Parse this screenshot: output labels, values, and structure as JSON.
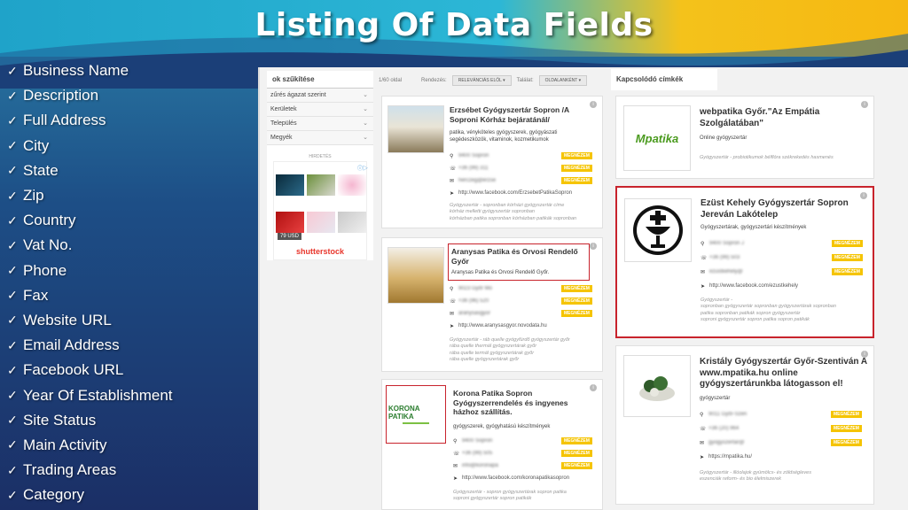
{
  "slide": {
    "title": "Listing Of Data Fields",
    "fields": [
      "Business Name",
      "Description",
      "Full Address",
      "City",
      "State",
      "Zip",
      "Country",
      "Vat No.",
      "Phone",
      "Fax",
      "Website URL",
      "Email Address",
      "Facebook URL",
      "Year Of Establishment",
      "Site Status",
      "Main Activity",
      "Trading Areas",
      "Category"
    ]
  },
  "colors": {
    "accent_red": "#c8232c",
    "badge_yellow": "#f5c400",
    "title_white": "#ffffff"
  },
  "screenshot": {
    "sidebar": {
      "header": "ok szűkítése",
      "items": [
        "zűrés ágazat szerint",
        "Kerületek",
        "Település",
        "Megyék"
      ],
      "ad_label": "HIRDETÉS",
      "ad_price": "79 USD",
      "ad_logo": "shutterstock"
    },
    "toolbar": {
      "pages": "1/60 oldal",
      "sort_label": "Rendezés:",
      "sort_value": "RELEVÁNCIÁS ELŐL",
      "hits_label": "Találat:",
      "hits_value": "OLDALANKÉNT"
    },
    "related_header": "Kapcsolódó címkék",
    "badge_label": "MEGNÉZEM",
    "cards": [
      {
        "title": "Erzsébet Gyógyszertár Sopron /A Soproni Kórház bejáratánál/",
        "subtitle": "patika, vényköteles gyógyszerek, gyógyászati segédeszközök, vitaminok, kozmetikumok",
        "address": "9400 Sopron",
        "phone": "+36 (99) 311",
        "email": "herczeg@erzse",
        "url": "http://www.facebook.com/ErzsebetPatikaSopron",
        "tags": [
          "Gyógyszertár - sopronban kórházi gyógyszertár címe",
          "kórház melletti gyógyszertár sopronban",
          "kórházban patika sopronban kórházban patikák sopronban"
        ]
      },
      {
        "title": "Aranysas Patika és Orvosi Rendelő Győr",
        "subtitle": "Aranysas Patika és Orvosi Rendelő Győr.",
        "address": "9023 Győr Mo",
        "phone": "+36 (96) 520",
        "email": "aranysasgyor",
        "url": "http://www.aranysasgyor.novodata.hu",
        "tags": [
          "Gyógyszertár - ráb quelle gyógyfürdő gyógyszertár győr",
          "rába quelle thermál gyógyszertárak győr",
          "rába quelle termál gyógyszertárak győr",
          "rába quelle gyógyszertárak győr"
        ]
      },
      {
        "title": "Korona Patika Sopron Gyógyszerrendelés és ingyenes házhoz szállítás.",
        "subtitle": "gyógyszerek, gyógyhatású készítmények",
        "logo_text": "KORONA PATIKA",
        "address": "9400 Sopron",
        "phone": "+36 (99) 505",
        "email": "info@koronapa",
        "url": "http://www.facebook.com/koronapatikasopron",
        "tags": [
          "Gyógyszertár - sopron gyógyszertárak sopron patika",
          "soproni gyógyszertár sopron patikák"
        ]
      },
      {
        "title": "webpatika Győr.\"Az Empátia Szolgálatában\"",
        "subtitle": "Online gyógyszertár",
        "logo_text": "Mpatika",
        "tags": [
          "Gyógyszertár - probiotikumok bélflóra székrekedés hasmenés"
        ]
      },
      {
        "title": "Ezüst Kehely Gyógyszertár Sopron Jereván Lakótelep",
        "subtitle": "Gyógyszertárak, gyógyszertári készítmények",
        "address": "9400 Sopron J",
        "phone": "+36 (99) 503",
        "email": "ezustkehely@",
        "url": "http://www.facebook.com/ezustkehely",
        "tags": [
          "Gyógyszertár -",
          "sopronban gyógyszertár sopronban gyógyszertárak sopronban",
          "patika sopronban patikák sopron gyógyszertár",
          "soproni gyógyszertár sopron patika sopron patikák"
        ]
      },
      {
        "title": "Kristály Gyógyszertár Győr-Szentiván A www.mpatika.hu online gyógyszertárunkba látogasson el!",
        "subtitle": "gyógyszertár",
        "address": "9011 Győr-Szen",
        "phone": "+36 (20) 964",
        "email": "gyogyszertar@",
        "url": "https://mpatika.hu/",
        "tags": [
          "Gyógyszertár - illóolajok gyümölcs- és zöldségleves",
          "eszenciák reform- és bio élelmiszerek"
        ]
      }
    ]
  }
}
